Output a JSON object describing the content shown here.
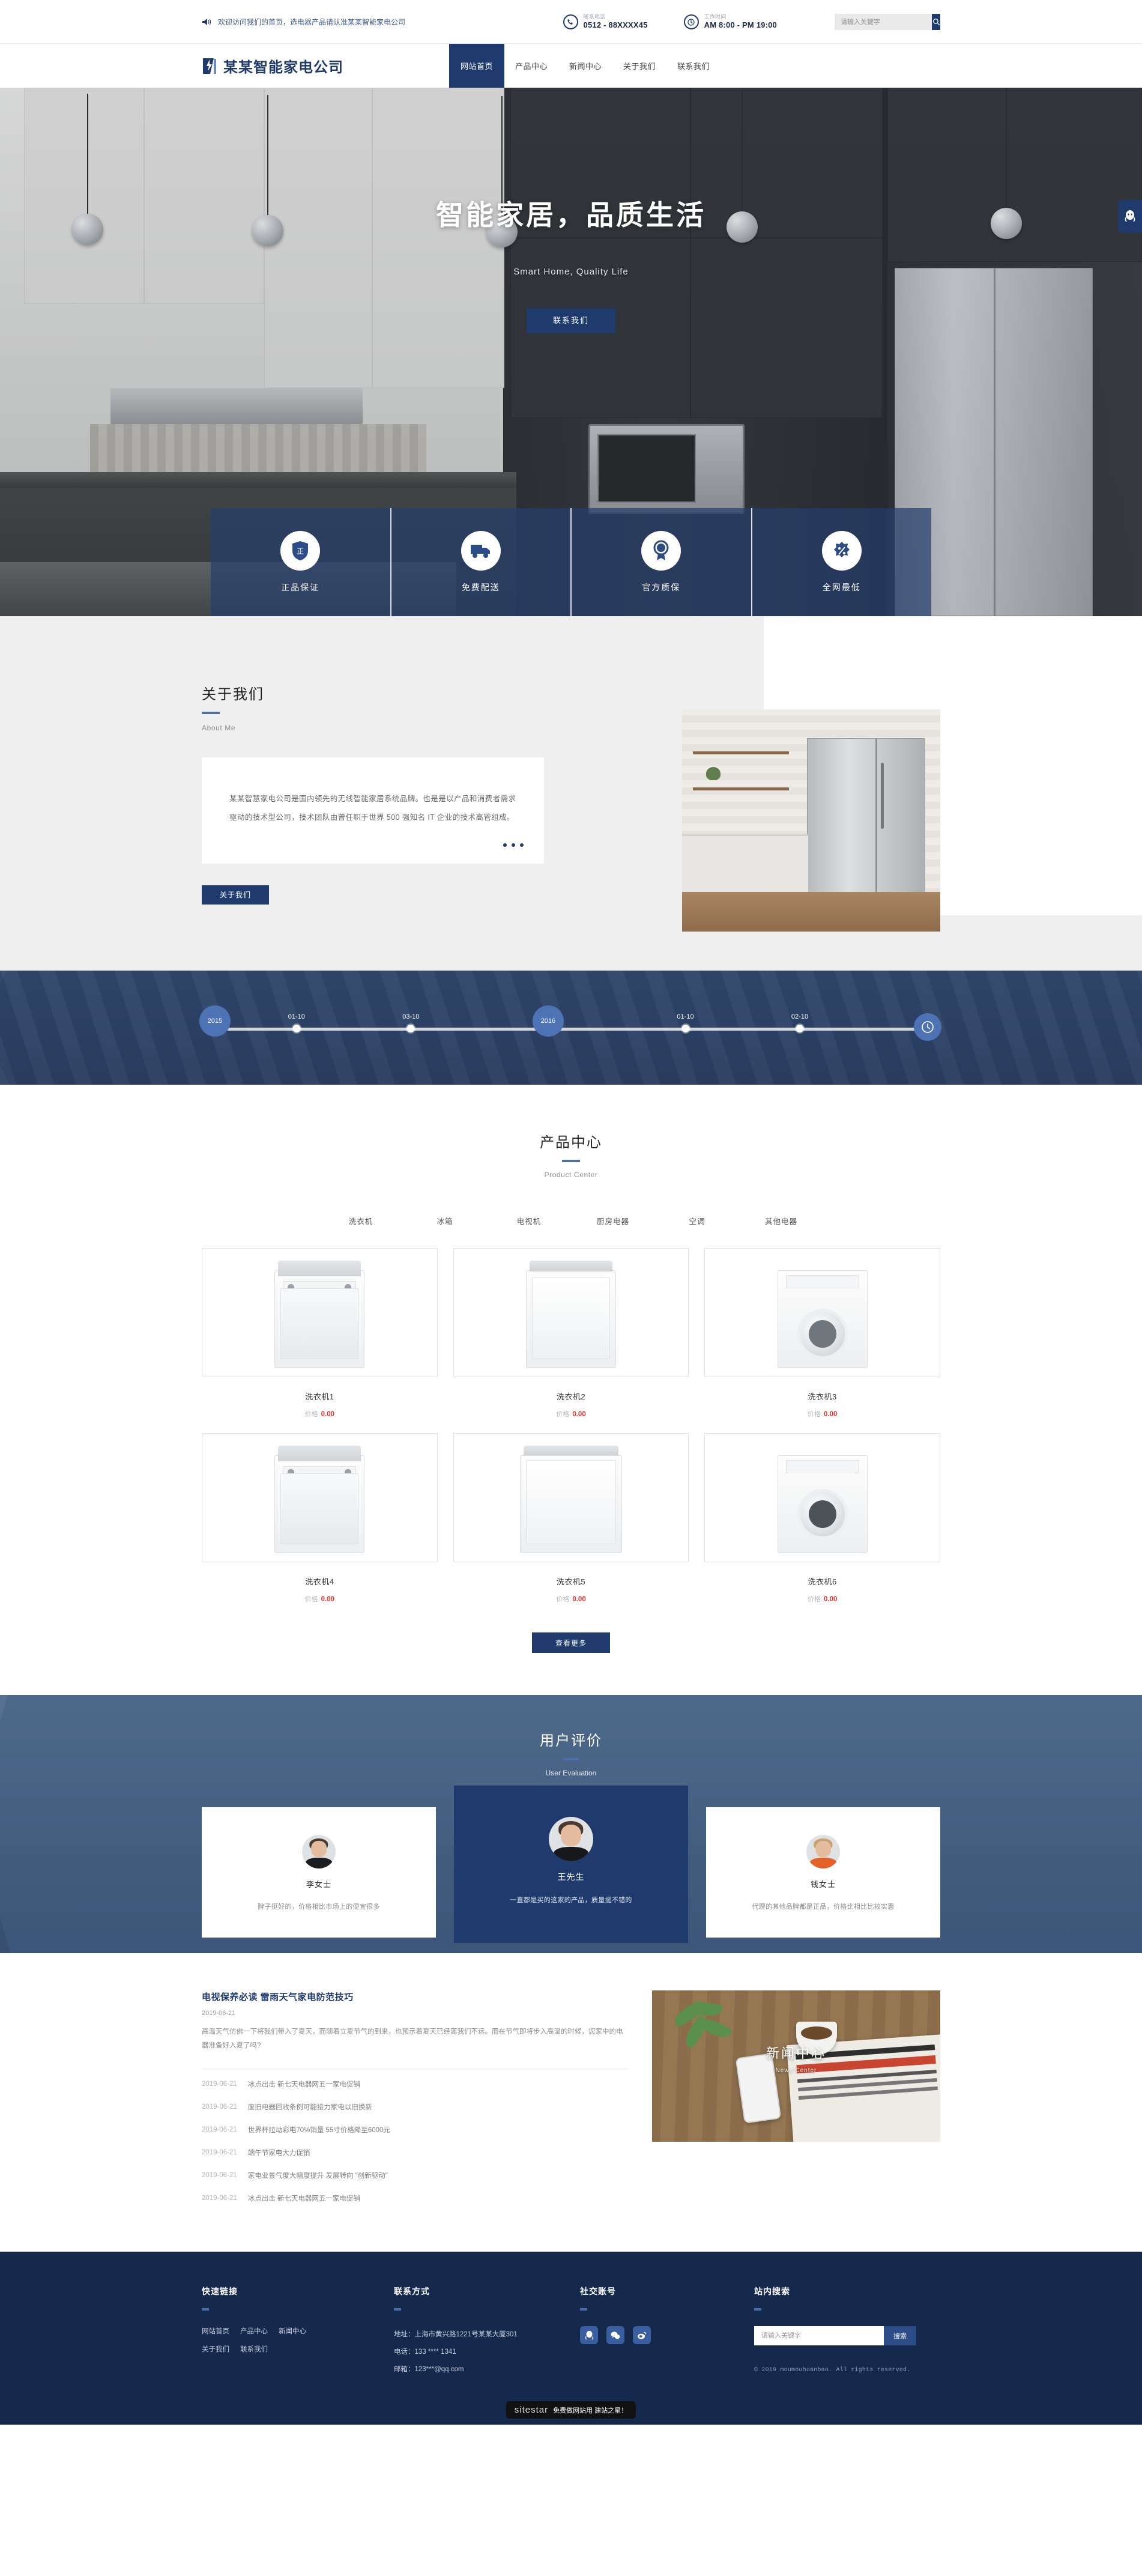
{
  "topbar": {
    "welcome": "欢迎访问我们的首页，选电器产品请认准某某智能家电公司",
    "horn_icon": "megaphone-icon",
    "phone": {
      "icon": "phone-icon",
      "label": "联系电话",
      "value": "0512 - 88XXXX45"
    },
    "hours": {
      "icon": "clock-icon",
      "label": "工作时间",
      "value": "AM 8:00 - PM 19:00"
    },
    "search": {
      "placeholder": "请输入关键字",
      "value": "",
      "icon": "search-icon"
    }
  },
  "header": {
    "logo_text": "某某智能家电公司",
    "logo_icon": "company-logo-icon",
    "nav": [
      {
        "label": "网站首页",
        "active": true
      },
      {
        "label": "产品中心",
        "active": false
      },
      {
        "label": "新闻中心",
        "active": false
      },
      {
        "label": "关于我们",
        "active": false
      },
      {
        "label": "联系我们",
        "active": false
      }
    ]
  },
  "hero": {
    "title": "智能家居，品质生活",
    "subtitle": "Smart Home, Quality Life",
    "button": "联系我们",
    "side_tab_icon": "qq-icon"
  },
  "features": [
    {
      "icon": "shield-zheng-icon",
      "label": "正品保证"
    },
    {
      "icon": "truck-icon",
      "label": "免费配送"
    },
    {
      "icon": "badge-icon",
      "label": "官方质保"
    },
    {
      "icon": "percent-tag-icon",
      "label": "全网最低"
    }
  ],
  "about": {
    "title": "关于我们",
    "subtitle": "About Me",
    "paragraph": "某某智慧家电公司是国内领先的无线智能家居系统品牌。也是是以产品和消费者需求驱动的技术型公司，技术团队由曾任职于世界 500 强知名 IT 企业的技术高管组成。",
    "button": "关于我们",
    "dots": 3
  },
  "timeline": {
    "start_year": "2015",
    "mid_year": "2016",
    "nodes": [
      {
        "date": "01-10",
        "pos": 14
      },
      {
        "date": "03-10",
        "pos": 29
      },
      {
        "date": "01-10",
        "pos": 62
      },
      {
        "date": "02-10",
        "pos": 77
      }
    ],
    "end_icon": "clock-icon"
  },
  "products": {
    "title": "产品中心",
    "subtitle": "Product Center",
    "tabs": [
      "洗衣机",
      "冰箱",
      "电视机",
      "厨房电器",
      "空调",
      "其他电器"
    ],
    "price_label": "价格:",
    "items": [
      {
        "name": "洗衣机1",
        "price": "0.00",
        "style": "toploader"
      },
      {
        "name": "洗衣机2",
        "price": "0.00",
        "style": "toploader2"
      },
      {
        "name": "洗衣机3",
        "price": "0.00",
        "style": "frontloader"
      },
      {
        "name": "洗衣机4",
        "price": "0.00",
        "style": "toploader"
      },
      {
        "name": "洗衣机5",
        "price": "0.00",
        "style": "toploader2"
      },
      {
        "name": "洗衣机6",
        "price": "0.00",
        "style": "frontloader"
      }
    ],
    "more_button": "查看更多"
  },
  "evaluation": {
    "title": "用户评价",
    "subtitle": "User Evaluation",
    "cards": [
      {
        "name": "李女士",
        "text": "牌子挺好的，价格相比市场上的便宜很多",
        "featured": false,
        "avatar": "avatar-female-1"
      },
      {
        "name": "王先生",
        "text": "一直都是买的这家的产品，质量挺不错的",
        "featured": true,
        "avatar": "avatar-male-1"
      },
      {
        "name": "钱女士",
        "text": "代理的其他品牌都是正品，价格比相比比较实惠",
        "featured": false,
        "avatar": "avatar-female-2"
      }
    ]
  },
  "news": {
    "feature": {
      "title": "电视保养必读 雷雨天气家电防范技巧",
      "date": "2019-06-21",
      "desc": "高温天气仿佛一下将我们带入了夏天，而随着立夏节气的到来，也预示着夏天已经离我们不远。而在节气即将步入高温的时候，您家中的电器准备好入夏了吗?"
    },
    "items": [
      {
        "date": "2019-06-21",
        "text": "冰点出击 新七天电器网五一家电促销"
      },
      {
        "date": "2019-06-21",
        "text": "废旧电器回收条例可能接力家电以旧换新"
      },
      {
        "date": "2019-06-21",
        "text": "世界杯拉动彩电70%销量 55寸价格降至6000元"
      },
      {
        "date": "2019-06-21",
        "text": "端午节家电大力促销"
      },
      {
        "date": "2019-06-21",
        "text": "家电业景气度大幅度提升 发展转向 \"创新驱动\""
      },
      {
        "date": "2019-06-21",
        "text": "冰点出击 新七天电器网五一家电促销"
      }
    ],
    "banner": {
      "title": "新闻中心",
      "subtitle": "News Center"
    }
  },
  "footer": {
    "quicklinks": {
      "heading": "快速链接",
      "items": [
        "网站首页",
        "产品中心",
        "新闻中心",
        "关于我们",
        "联系我们"
      ]
    },
    "contact": {
      "heading": "联系方式",
      "address": "地址：上海市黄兴路1221号某某大厦301",
      "phone": "电话：133 **** 1341",
      "email": "邮箱：123***@qq.com"
    },
    "social": {
      "heading": "社交账号",
      "icons": [
        "qq-icon",
        "wechat-icon",
        "weibo-icon"
      ]
    },
    "sitesearch": {
      "heading": "站内搜索",
      "placeholder": "请输入关键字",
      "value": "",
      "button": "搜索",
      "copyright": "© 2019 moumouhuanbao. All rights reserved."
    },
    "sitestar": {
      "logo": "sitestar",
      "text": "免费做网站用 建站之星！"
    }
  },
  "colors": {
    "brand": "#1f3b6e",
    "brand_dark": "#15294d",
    "accent": "#4a6fae",
    "price_red": "#e8332a"
  }
}
